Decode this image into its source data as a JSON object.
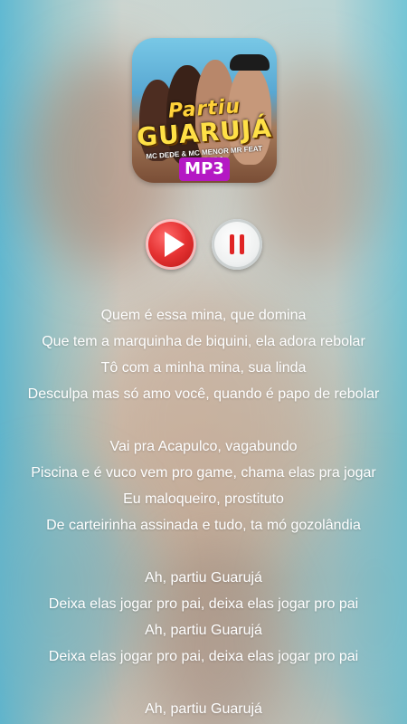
{
  "album": {
    "title_line1": "Partiu",
    "title_line2": "GUARUJÁ",
    "credits": "MC DEDE & MC MENOR MR FEAT MITICO DJ",
    "format_badge": "MP3"
  },
  "controls": {
    "play_icon": "play-icon",
    "pause_icon": "pause-icon",
    "accent_color": "#e53232"
  },
  "lyrics": [
    "Quem é essa mina, que domina",
    "Que tem a marquinha de biquini, ela adora rebolar",
    "Tô com a minha mina, sua linda",
    "Desculpa mas só amo você, quando é papo de rebolar",
    "",
    "Vai pra Acapulco, vagabundo",
    "Piscina e é vuco vem pro game, chama elas pra jogar",
    "Eu maloqueiro, prostituto",
    "De carteirinha assinada e tudo, ta mó gozolândia",
    "",
    "Ah, partiu Guarujá",
    "Deixa elas jogar pro pai, deixa elas jogar pro pai",
    "Ah, partiu Guarujá",
    "Deixa elas jogar pro pai, deixa elas jogar pro pai",
    "",
    "Ah, partiu Guarujá"
  ]
}
